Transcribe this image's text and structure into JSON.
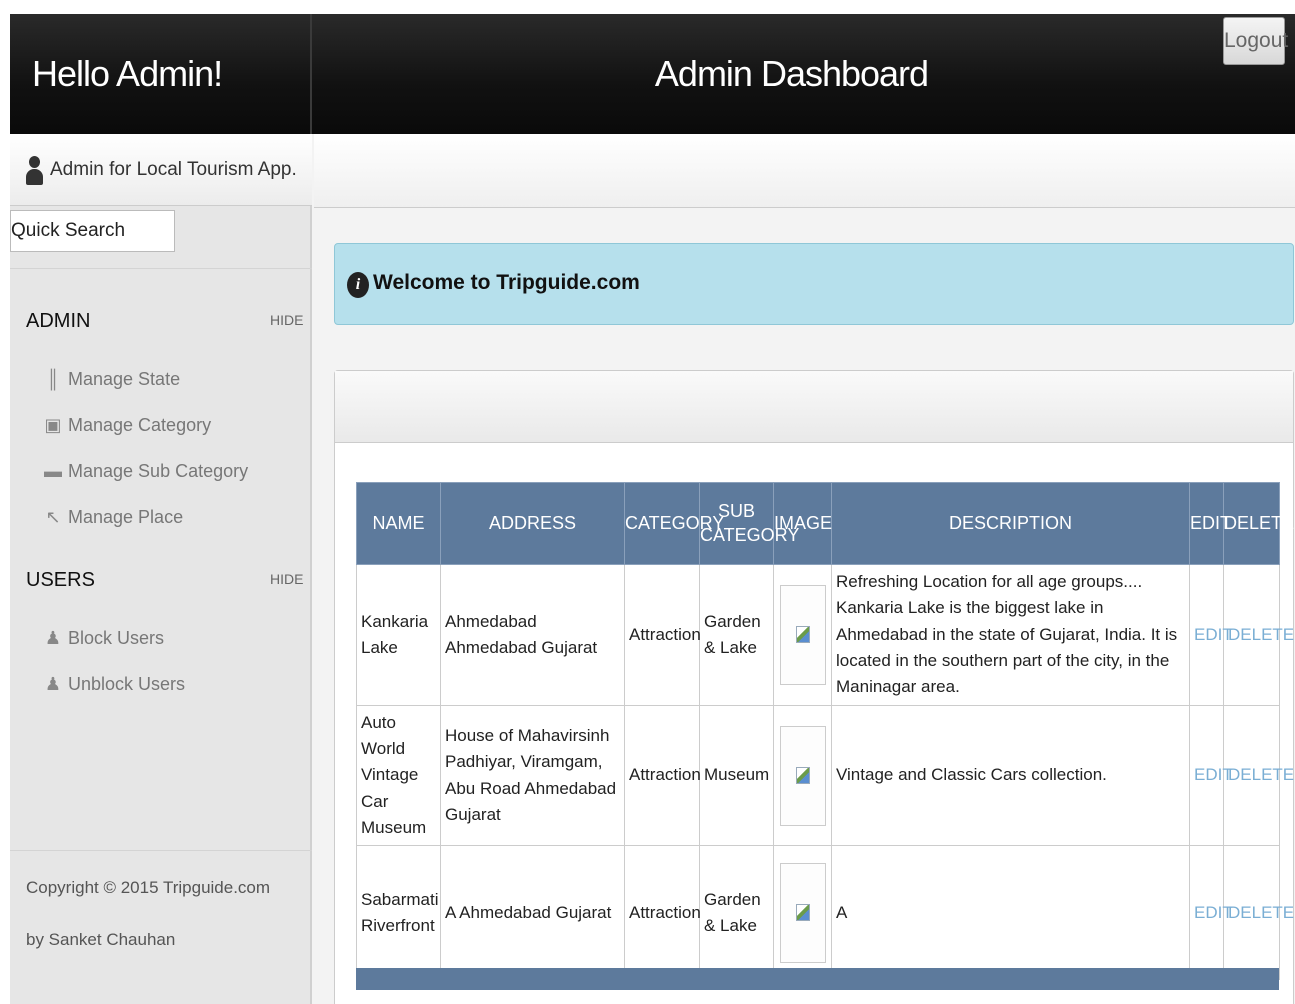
{
  "header": {
    "greeting": "Hello Admin!",
    "title": "Admin Dashboard",
    "logout_label": "Logout"
  },
  "sidebar": {
    "user_label": "Admin for Local Tourism App.",
    "search_value": "Quick Search",
    "sections": [
      {
        "title": "ADMIN",
        "hide_label": "HIDE",
        "items": [
          {
            "label": "Manage State",
            "icon": "utensils-icon"
          },
          {
            "label": "Manage Category",
            "icon": "lock-icon"
          },
          {
            "label": "Manage Sub Category",
            "icon": "folder-icon"
          },
          {
            "label": "Manage Place",
            "icon": "cursor-icon"
          }
        ]
      },
      {
        "title": "USERS",
        "hide_label": "HIDE",
        "items": [
          {
            "label": "Block Users",
            "icon": "user-block-icon"
          },
          {
            "label": "Unblock Users",
            "icon": "user-unblock-icon"
          }
        ]
      }
    ],
    "copyright": "Copyright © 2015 Tripguide.com",
    "author": "by Sanket Chauhan"
  },
  "alert": {
    "message": "Welcome to Tripguide.com"
  },
  "table": {
    "headers": [
      "NAME",
      "ADDRESS",
      "CATEGORY",
      "SUB CATEGORY",
      "IMAGE",
      "DESCRIPTION",
      "EDIT",
      "DELETE"
    ],
    "rows": [
      {
        "name": "Kankaria Lake",
        "address": "Ahmedabad Ahmedabad Gujarat",
        "category": "Attraction",
        "sub_category": "Garden & Lake",
        "description": "Refreshing Location for all age groups.... Kankaria Lake is the biggest lake in Ahmedabad in the state of Gujarat, India. It is located in the southern part of the city, in the Maninagar area.",
        "edit": "EDIT",
        "delete": "DELETE"
      },
      {
        "name": "Auto World Vintage Car Museum",
        "address": "House of Mahavirsinh Padhiyar, Viramgam, Abu Road Ahmedabad Gujarat",
        "category": "Attraction",
        "sub_category": "Museum",
        "description": "Vintage and Classic Cars collection.",
        "edit": "EDIT",
        "delete": "DELETE"
      },
      {
        "name": "Sabarmati Riverfront",
        "address": "A Ahmedabad Gujarat",
        "category": "Attraction",
        "sub_category": "Garden & Lake",
        "description": "A",
        "edit": "EDIT",
        "delete": "DELETE"
      }
    ]
  }
}
